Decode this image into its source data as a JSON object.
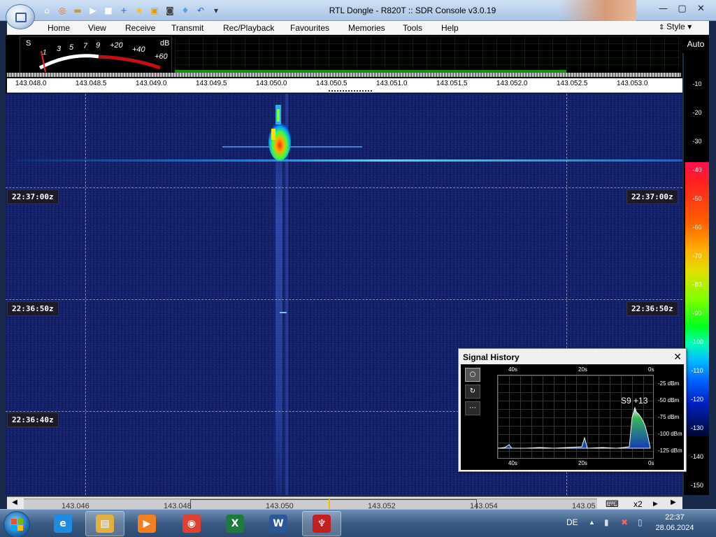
{
  "window": {
    "title": "RTL Dongle - R820T :: SDR Console v3.0.19",
    "controls": {
      "minimize": "—",
      "maximize": "▢",
      "close": "✕"
    }
  },
  "quick_access": [
    {
      "icon": "home-icon",
      "glyph": "⌂",
      "color": "#ffffff"
    },
    {
      "icon": "lifebuoy-icon",
      "glyph": "◎",
      "color": "#ff6a00"
    },
    {
      "icon": "folder-icon",
      "glyph": "▬",
      "color": "#c89a3a"
    },
    {
      "icon": "play-icon",
      "glyph": "▶",
      "color": "#ffffff"
    },
    {
      "icon": "stop-icon",
      "glyph": "■",
      "color": "#ffffff"
    },
    {
      "icon": "add-icon",
      "glyph": "+",
      "color": "#2a6ad0"
    },
    {
      "icon": "star-icon",
      "glyph": "★",
      "color": "#ffc000"
    },
    {
      "icon": "lock-icon",
      "glyph": "▣",
      "color": "#e0a000"
    },
    {
      "icon": "camera-icon",
      "glyph": "◙",
      "color": "#444444"
    },
    {
      "icon": "drop-icon",
      "glyph": "♦",
      "color": "#5aa0e0"
    },
    {
      "icon": "undo-icon",
      "glyph": "↶",
      "color": "#2a6ad0"
    },
    {
      "icon": "dropdown-icon",
      "glyph": "▾",
      "color": "#333333"
    }
  ],
  "menu": [
    "Home",
    "View",
    "Receive",
    "Transmit",
    "Rec/Playback",
    "Favourites",
    "Memories",
    "Tools",
    "Help"
  ],
  "style_label": "Style",
  "style_caret": "▾",
  "smeter": {
    "s_label": "S",
    "db_label": "dB",
    "scale": [
      "1",
      "3",
      "5",
      "7",
      "9",
      "+20",
      "+40",
      "+60"
    ]
  },
  "freq_ruler": [
    "143.048.0",
    "143.048.5",
    "143.049.0",
    "143.049.5",
    "143.050.0",
    "143.050.5",
    "143.051.0",
    "143.051.5",
    "143.052.0",
    "143.052.5",
    "143.053.0"
  ],
  "waterfall_times": [
    "22:37:00z",
    "22:36:50z",
    "22:36:40z"
  ],
  "colorbar": {
    "auto_label": "Auto",
    "levels": [
      "-10",
      "-20",
      "-30",
      "-40",
      "-50",
      "-60",
      "-70",
      "-80",
      "-90",
      "-100",
      "-110",
      "-120",
      "-130",
      "-140",
      "-150"
    ]
  },
  "signal_history": {
    "title": "Signal History",
    "close": "✕",
    "buttons": [
      "○",
      "↻",
      "⋯"
    ],
    "top_ticks": [
      "40s",
      "20s",
      "0s"
    ],
    "bottom_ticks": [
      "40s",
      "20s",
      "0s"
    ],
    "y_labels": [
      "-25 dBm",
      "-50 dBm",
      "-75 dBm",
      "-100 dBm",
      "-125 dBm"
    ],
    "peak_label": "S9 +13"
  },
  "bottom_scroll": {
    "freqs": [
      "143.046",
      "143.048",
      "143.050",
      "143.052",
      "143.054",
      "143.05"
    ],
    "zoom_label": "x2",
    "left_arrow": "◀",
    "right_arrow": "▶",
    "keyboard_glyph": "⌨"
  },
  "taskbar": {
    "apps": [
      {
        "name": "internet-explorer",
        "glyph": "e",
        "color": "#1e8ae0"
      },
      {
        "name": "file-explorer",
        "glyph": "▤",
        "color": "#e0b040"
      },
      {
        "name": "media-player",
        "glyph": "▶",
        "color": "#f08020"
      },
      {
        "name": "chrome",
        "glyph": "◉",
        "color": "#e04030"
      },
      {
        "name": "excel",
        "glyph": "X",
        "color": "#1e7a3e"
      },
      {
        "name": "word",
        "glyph": "W",
        "color": "#2b579a"
      },
      {
        "name": "sdr-console",
        "glyph": "♆",
        "color": "#c02020"
      }
    ],
    "language": "DE",
    "tray_glyphs": [
      "▲",
      "▮",
      "✖",
      "▯"
    ],
    "time": "22:37",
    "date": "28.06.2024"
  }
}
